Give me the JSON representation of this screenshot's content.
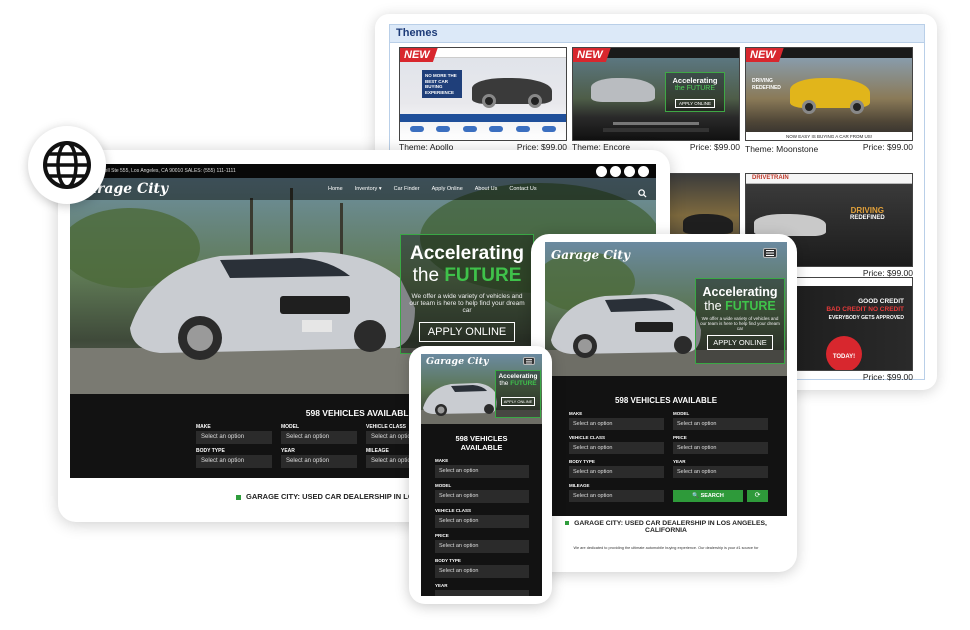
{
  "themes": {
    "header": "Themes",
    "tiles": [
      {
        "name_line": "Theme: Apollo",
        "price": "Price: $99.00",
        "badge": "NEW"
      },
      {
        "name_line": "Theme: Encore",
        "price": "Price: $99.00",
        "badge": "NEW"
      },
      {
        "name_line": "Theme: Moonstone",
        "price": "Price: $99.00",
        "badge": "NEW"
      },
      {
        "price": "Price: $99.00"
      },
      {
        "price": "Price: $99.00"
      }
    ],
    "tile_texts": {
      "apollo_promo": "NO MORE THE BEST CAR BUYING EXPERIENCE",
      "encore_l1": "Accelerating",
      "encore_l2": "the FUTURE",
      "encore_apply": "APPLY ONLINE",
      "moonstone_promo": "DRIVING REDEFINED",
      "moonstone_banner": "NOW EASY IS BUYING A CAR FROM US!",
      "drivetrain_logo": "DRIVETRAIN",
      "drivetrain_l1": "DRIVING",
      "drivetrain_l2": "REDEFINED",
      "credit_l1": "GOOD CREDIT",
      "credit_l2": "BAD CREDIT NO CREDIT",
      "credit_l3": "EVERYBODY GETS APPROVED",
      "credit_today": "TODAY!"
    }
  },
  "desktop": {
    "topbar": "ore Shell Ste 555, Los Angeles, CA 90010   SALES: (555) 111-1111",
    "logo": "Garage City",
    "nav": [
      "Home",
      "Inventory ▾",
      "Car Finder",
      "Apply Online",
      "About Us",
      "Contact Us"
    ],
    "hero_l1": "Accelerating",
    "hero_l2_a": "the",
    "hero_l2_b": "FUTURE",
    "hero_desc": "We offer a wide variety of vehicles and our team is here to help find your dream car",
    "apply": "APPLY ONLINE",
    "vehicles_title": "598 VEHICLES AVAILABLE",
    "fields": {
      "make": "MAKE",
      "model": "MODEL",
      "vehicle_class": "VEHICLE CLASS",
      "body_type": "BODY TYPE",
      "year": "YEAR",
      "mileage": "MILEAGE",
      "placeholder": "Select an option"
    },
    "tagline": "GARAGE CITY: USED CAR DEALERSHIP IN LOS AN"
  },
  "tablet": {
    "logo": "Garage City",
    "hero_l1": "Accelerating",
    "hero_l2_a": "the",
    "hero_l2_b": "FUTURE",
    "hero_desc": "We offer a wide variety of vehicles and our team is here to help find your dream car",
    "apply": "APPLY ONLINE",
    "vehicles_title": "598 VEHICLES AVAILABLE",
    "fields": {
      "make": "MAKE",
      "model": "MODEL",
      "vehicle_class": "VEHICLE CLASS",
      "price": "PRICE",
      "body_type": "BODY TYPE",
      "year": "YEAR",
      "mileage": "MILEAGE",
      "placeholder": "Select an option"
    },
    "search_btn": "🔍 SEARCH",
    "reset_btn": "⟳",
    "tagline_l1": "GARAGE CITY: USED CAR DEALERSHIP IN LOS ANGELES,",
    "tagline_l2": "CALIFORNIA",
    "body": "We are dedicated to providing the ultimate automobile buying experience. Our dealership is your #1 source for"
  },
  "phone": {
    "logo": "Garage City",
    "hero_l1": "Accelerating",
    "hero_l2_a": "the",
    "hero_l2_b": "FUTURE",
    "apply": "APPLY ONLINE",
    "vehicles_l1": "598 VEHICLES",
    "vehicles_l2": "AVAILABLE",
    "fields": {
      "make": "MAKE",
      "model": "MODEL",
      "vehicle_class": "VEHICLE CLASS",
      "price": "PRICE",
      "body_type": "BODY TYPE",
      "year": "YEAR",
      "placeholder": "Select an option"
    }
  },
  "colors": {
    "accent_green": "#3fc24a",
    "badge_red": "#d8272e",
    "dark": "#121212"
  },
  "icons": [
    "globe-icon",
    "search-icon",
    "menu-icon",
    "facebook-icon",
    "twitter-icon",
    "instagram-icon",
    "youtube-icon",
    "reset-icon"
  ]
}
